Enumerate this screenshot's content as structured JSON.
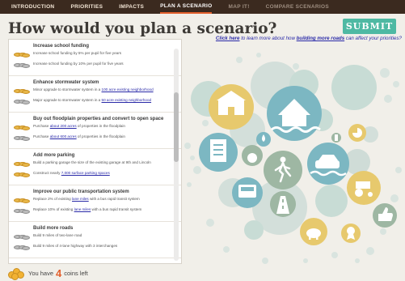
{
  "nav": {
    "tabs": [
      {
        "label": "INTRODUCTION",
        "state": "normal"
      },
      {
        "label": "PRIORITIES",
        "state": "normal"
      },
      {
        "label": "IMPACTS",
        "state": "normal"
      },
      {
        "label": "PLAN A SCENARIO",
        "state": "active"
      },
      {
        "label": "MAP IT!",
        "state": "dim"
      },
      {
        "label": "COMPARE SCENARIOS",
        "state": "dim"
      }
    ]
  },
  "title": "How would you plan a scenario?",
  "submit_label": "SUBMIT",
  "learn_more": {
    "link": "Click here",
    "text1": " to learn more about how ",
    "bold": "building more roads",
    "text2": " can affect your priorities?"
  },
  "sections": [
    {
      "heading": "Increase school funding",
      "options": [
        {
          "coins": "gold",
          "text": "Increase school funding by 5% per pupil for five years"
        },
        {
          "coins": "gray",
          "text": "Increase school funding by 10% per pupil for five years"
        }
      ]
    },
    {
      "heading": "Enhance stormwater system",
      "options": [
        {
          "coins": "gold",
          "pre": "Minor upgrade to stormwater system in a ",
          "link": "100 acre existing neighborhood",
          "post": ""
        },
        {
          "coins": "gray",
          "pre": "Major upgrade to stormwater system in a ",
          "link": "50 acre existing neighborhood",
          "post": ""
        }
      ]
    },
    {
      "heading": "Buy out floodplain properties and convert to open space",
      "options": [
        {
          "coins": "gold",
          "pre": "Purchase ",
          "link": "about 200 acres",
          "post": " of properties in the floodplain"
        },
        {
          "coins": "gray",
          "pre": "Purchase ",
          "link": "about 600 acres",
          "post": " of properties in the floodplain"
        }
      ]
    },
    {
      "heading": "Add more parking",
      "options": [
        {
          "coins": "gold",
          "text": "Build a parking garage the size of the existing garage at 9th and Lincoln"
        },
        {
          "coins": "gold",
          "pre": "Construct nearly ",
          "link": "7,000 surface parking spaces",
          "post": ""
        }
      ]
    },
    {
      "heading": "Improve our public transportation system",
      "options": [
        {
          "coins": "gold",
          "pre": "Replace 2% of existing ",
          "link": "lane miles",
          "post": " with a bus rapid transit system"
        },
        {
          "coins": "gray",
          "pre": "Replace 10% of existing ",
          "link": "lane miles",
          "post": " with a bus rapid transit system"
        }
      ]
    },
    {
      "heading": "Build more roads",
      "options": [
        {
          "coins": "gray",
          "text": "Build 9 miles of two-lane road"
        },
        {
          "coins": "gray",
          "text": "Build 9 miles of 4-lane highway with 3 interchanges"
        }
      ]
    }
  ],
  "coins_left": {
    "prefix": "You have",
    "count": "4",
    "suffix": "coins left"
  },
  "colors": {
    "accent": "#e35f2c",
    "teal": "#4eb9a3",
    "navbar": "#3b2a1f",
    "coin_gold": "#e8b84a",
    "coin_gray": "#bdbdbd"
  },
  "icons": [
    "school-icon",
    "house-flood-icon",
    "document-icon",
    "pedestrian-icon",
    "flooded-car-icon",
    "bus-icon",
    "tractor-icon",
    "thumbs-up-icon",
    "award-ribbon-icon",
    "piggy-bank-icon",
    "money-bag-icon",
    "drop-icon",
    "pie-chart-icon",
    "building-icon"
  ]
}
